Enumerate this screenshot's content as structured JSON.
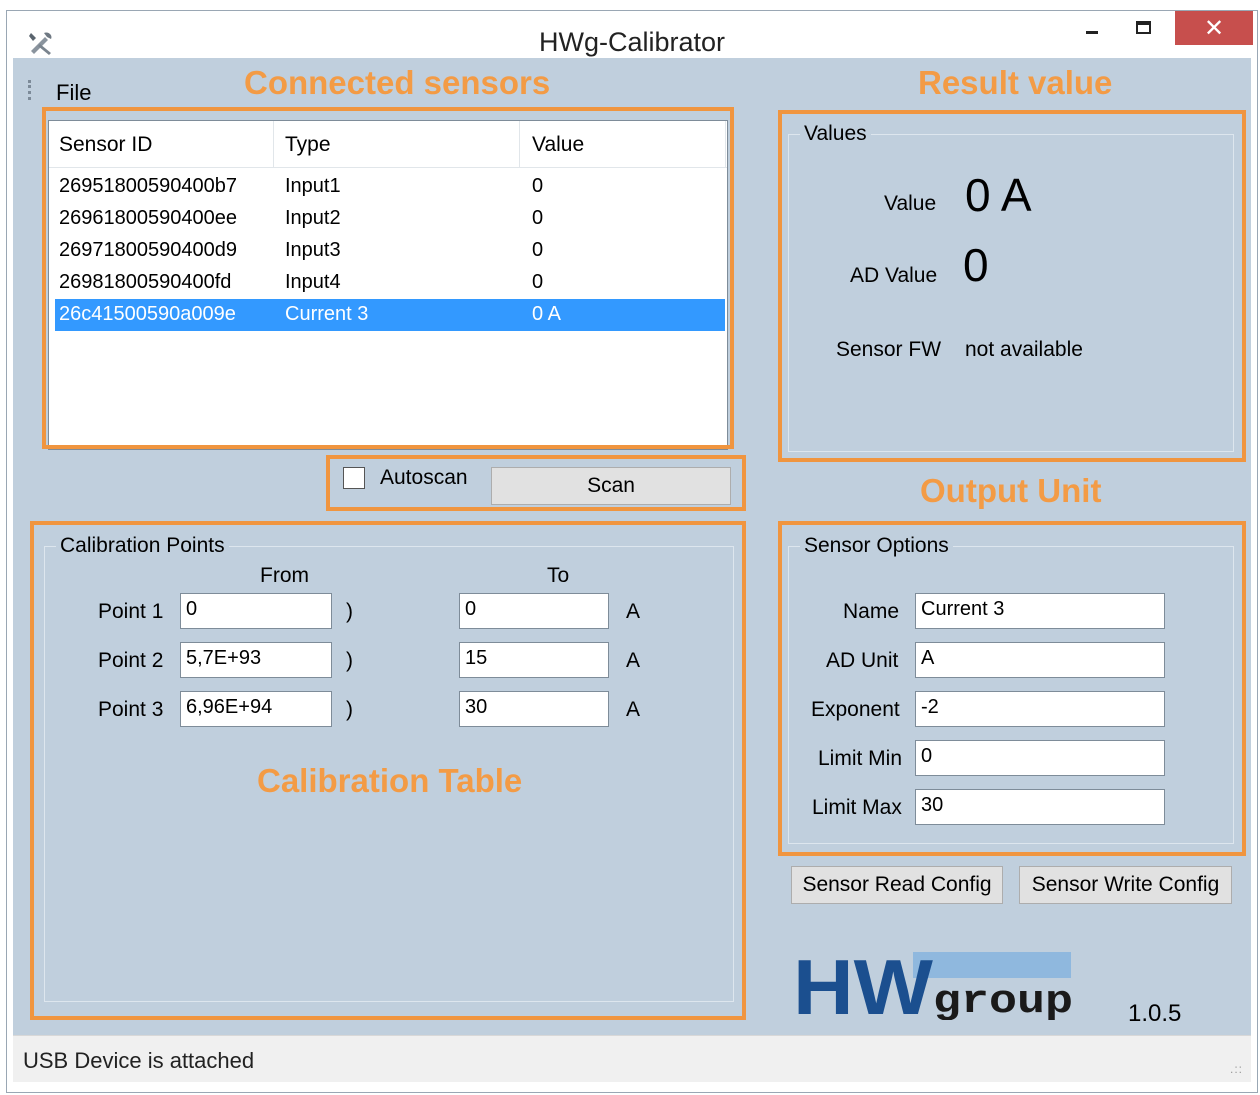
{
  "window": {
    "title": "HWg-Calibrator",
    "close_glyph": "✕",
    "min_glyph": "–",
    "max_glyph": "☐"
  },
  "menu": {
    "file": "File"
  },
  "annotations": {
    "connected_sensors": "Connected sensors",
    "result_value": "Result value",
    "output_unit": "Output Unit",
    "calibration_table": "Calibration Table"
  },
  "sensor_list": {
    "columns": [
      "Sensor ID",
      "Type",
      "Value"
    ],
    "rows": [
      {
        "id": "26951800590400b7",
        "type": "Input1",
        "value": "0"
      },
      {
        "id": "26961800590400ee",
        "type": "Input2",
        "value": "0"
      },
      {
        "id": "26971800590400d9",
        "type": "Input3",
        "value": "0"
      },
      {
        "id": "26981800590400fd",
        "type": "Input4",
        "value": "0"
      },
      {
        "id": "26c41500590a009e",
        "type": "Current 3",
        "value": "0 A"
      }
    ],
    "selected_index": 4
  },
  "scan": {
    "autoscan_label": "Autoscan",
    "autoscan_checked": false,
    "scan_button": "Scan"
  },
  "values_group": {
    "title": "Values",
    "value_label": "Value",
    "value": "0 A",
    "ad_value_label": "AD Value",
    "ad_value": "0",
    "sensor_fw_label": "Sensor FW",
    "sensor_fw": "not available"
  },
  "calibration": {
    "title": "Calibration Points",
    "from_header": "From",
    "to_header": "To",
    "points": [
      {
        "label": "Point 1",
        "from": "0",
        "from_unit": ")",
        "to": "0",
        "to_unit": "A"
      },
      {
        "label": "Point 2",
        "from": "5,7E+93",
        "from_unit": ")",
        "to": "15",
        "to_unit": "A"
      },
      {
        "label": "Point 3",
        "from": "6,96E+94",
        "from_unit": ")",
        "to": "30",
        "to_unit": "A"
      }
    ]
  },
  "sensor_options": {
    "title": "Sensor Options",
    "fields": [
      {
        "label": "Name",
        "value": "Current 3"
      },
      {
        "label": "AD Unit",
        "value": "A"
      },
      {
        "label": "Exponent",
        "value": "-2"
      },
      {
        "label": "Limit Min",
        "value": "0"
      },
      {
        "label": "Limit Max",
        "value": "30"
      }
    ]
  },
  "buttons": {
    "read_config": "Sensor Read Config",
    "write_config": "Sensor Write Config"
  },
  "logo": {
    "text_hw": "HW",
    "text_group": "group"
  },
  "version": "1.0.5",
  "status": {
    "text": "USB Device is attached"
  },
  "colors": {
    "client_bg": "#c0cfdd",
    "annotation": "#f39b45",
    "selection": "#3399ff",
    "logo_blue": "#1b4f8f",
    "logo_light": "#8fb8de"
  }
}
